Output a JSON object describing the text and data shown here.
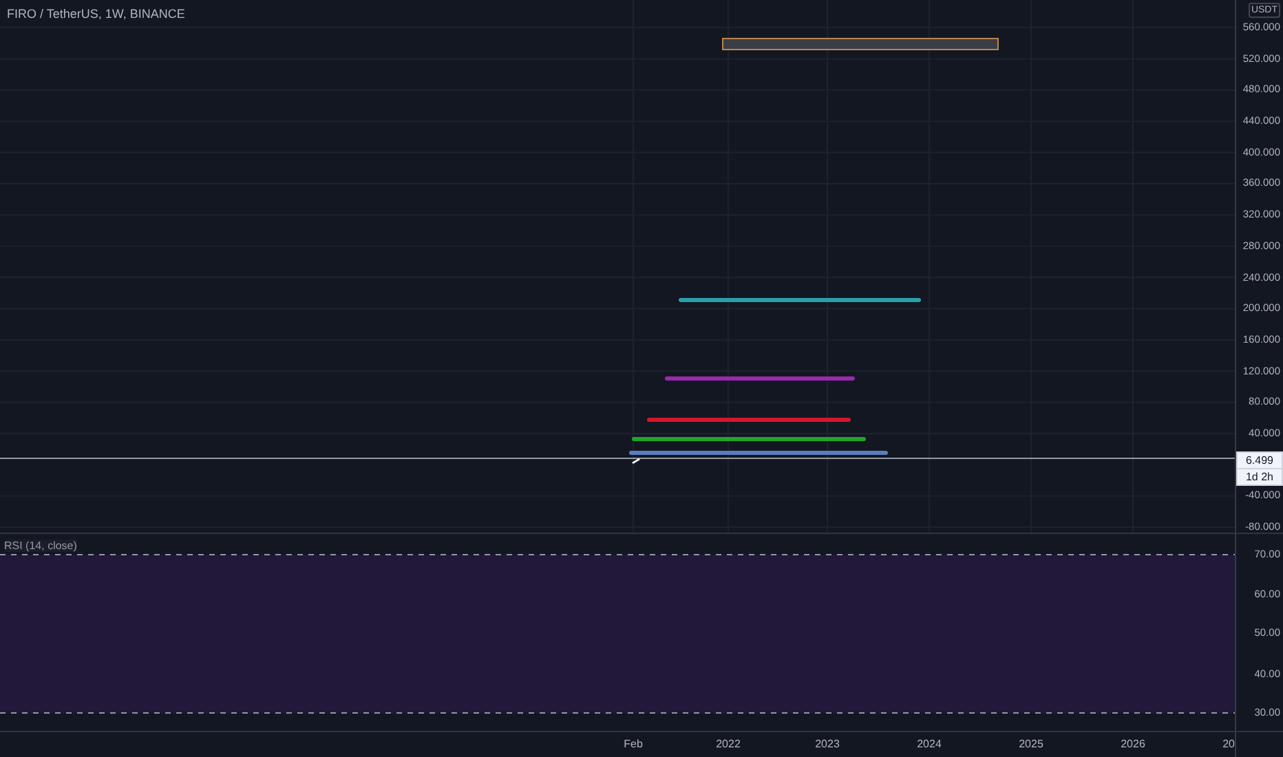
{
  "chart": {
    "title": "FIRO / TetherUS, 1W, BINANCE",
    "drawings": [
      {
        "kind": "rect",
        "color": "#b8864a"
      },
      {
        "kind": "line",
        "color": "#2a9fa8"
      },
      {
        "kind": "line",
        "color": "#9b27ae"
      },
      {
        "kind": "line",
        "color": "#d8162a"
      },
      {
        "kind": "line",
        "color": "#1ea62b"
      },
      {
        "kind": "line",
        "color": "#5a7dbd"
      }
    ]
  },
  "price_axis": {
    "unit": "USDT",
    "labels": [
      "560.000",
      "520.000",
      "480.000",
      "440.000",
      "400.000",
      "360.000",
      "320.000",
      "280.000",
      "240.000",
      "200.000",
      "160.000",
      "120.000",
      "80.000",
      "40.000",
      "-40.000",
      "-80.000"
    ],
    "last_price": "6.499",
    "countdown": "1d 2h"
  },
  "rsi": {
    "title": "RSI (14, close)",
    "labels": [
      "70.00",
      "60.00",
      "50.00",
      "40.00",
      "30.00"
    ]
  },
  "time_axis": {
    "labels": [
      "Feb",
      "2022",
      "2023",
      "2024",
      "2025",
      "2026",
      "20"
    ]
  }
}
